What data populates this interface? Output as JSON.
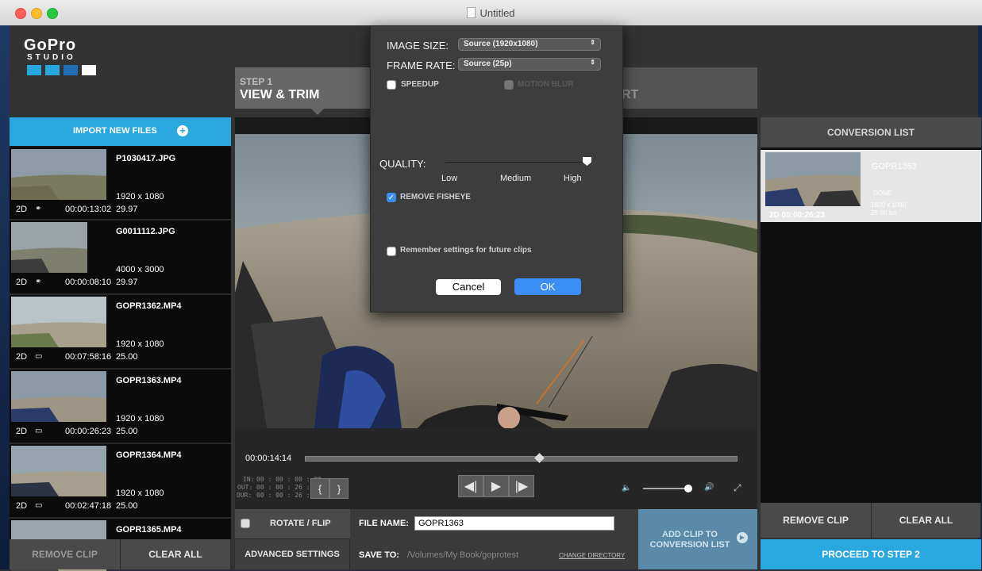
{
  "window": {
    "title": "Untitled"
  },
  "logo": {
    "brand": "GoPro",
    "product": "STUDIO"
  },
  "steps": {
    "step1_label": "STEP 1",
    "step1_title": "VIEW & TRIM",
    "step3_partial": "RT"
  },
  "import": {
    "label": "IMPORT NEW FILES"
  },
  "files": [
    {
      "name": "P1030417.JPG",
      "resolution": "1920 x 1080",
      "mode": "2D",
      "duration": "00:00:13:02",
      "fps": "29.97"
    },
    {
      "name": "G0011112.JPG",
      "resolution": "4000 x 3000",
      "mode": "2D",
      "duration": "00:00:08:10",
      "fps": "29.97"
    },
    {
      "name": "GOPR1362.MP4",
      "resolution": "1920 x 1080",
      "mode": "2D",
      "duration": "00:07:58:16",
      "fps": "25.00"
    },
    {
      "name": "GOPR1363.MP4",
      "resolution": "1920 x 1080",
      "mode": "2D",
      "duration": "00:00:26:23",
      "fps": "25.00"
    },
    {
      "name": "GOPR1364.MP4",
      "resolution": "1920 x 1080",
      "mode": "2D",
      "duration": "00:02:47:18",
      "fps": "25.00"
    },
    {
      "name": "GOPR1365.MP4",
      "resolution": "",
      "mode": "",
      "duration": "",
      "fps": ""
    }
  ],
  "left_buttons": {
    "remove": "REMOVE CLIP",
    "clear": "CLEAR ALL"
  },
  "player": {
    "current_time": "00:00:14:14",
    "in_label": "IN:",
    "in_value": "00 : 00 : 00 : 00",
    "out_label": "OUT:",
    "out_value": "00 : 00 : 26 : 23",
    "dur_label": "DUR:",
    "dur_value": "00 : 00 : 26 : 23",
    "progress": 0.54,
    "volume": 0.95
  },
  "bottom": {
    "rotate_flip": "ROTATE / FLIP",
    "advanced": "ADVANCED SETTINGS",
    "file_name_label": "FILE NAME:",
    "file_name_value": "GOPR1363",
    "save_to_label": "SAVE TO:",
    "save_to_value": "/Volumes/My Book/goprotest",
    "change_dir": "CHANGE DIRECTORY",
    "add_clip_line1": "ADD CLIP TO",
    "add_clip_line2": "CONVERSION LIST"
  },
  "conversion": {
    "title": "CONVERSION LIST",
    "item": {
      "name": "GOPR1363",
      "status": "DONE",
      "resolution": "1920 x 1080",
      "fps": "25.00 fps",
      "mode_duration": "2D 00:00:26:23"
    },
    "remove": "REMOVE CLIP",
    "clear": "CLEAR ALL",
    "proceed": "PROCEED TO STEP 2"
  },
  "modal": {
    "image_size_label": "IMAGE SIZE:",
    "image_size_value": "Source (1920x1080)",
    "frame_rate_label": "FRAME RATE:",
    "frame_rate_value": "Source (25p)",
    "speedup": "SPEEDUP",
    "motion_blur": "MOTION BLUR",
    "quality_label": "QUALITY:",
    "quality_low": "Low",
    "quality_medium": "Medium",
    "quality_high": "High",
    "quality_level": "High",
    "remove_fisheye": "REMOVE FISHEYE",
    "remember": "Remember settings for future clips",
    "cancel": "Cancel",
    "ok": "OK",
    "speedup_checked": false,
    "fisheye_checked": true,
    "remember_checked": false
  },
  "colors": {
    "accent": "#29a8e0",
    "ok_button": "#3b8ef5"
  }
}
